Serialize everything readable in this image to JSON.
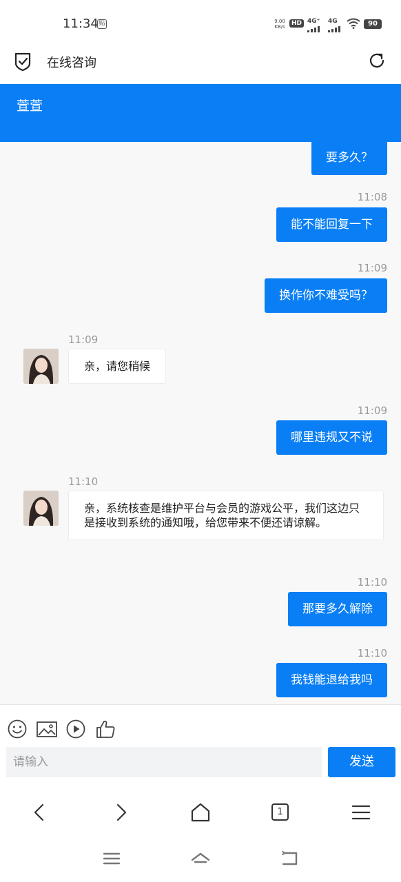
{
  "status_bar": {
    "time": "11:34",
    "tie_label": "贴",
    "net_speed_value": "9.00",
    "net_speed_unit": "KB/s",
    "hd_label": "HD",
    "sim1_label": "4G⁺",
    "sim2_label": "4G",
    "battery": "90"
  },
  "header": {
    "title": "在线咨询"
  },
  "banner": {
    "agent_name": "萱萱"
  },
  "messages": [
    {
      "side": "out",
      "text": "要多久？"
    },
    {
      "time": "11:08"
    },
    {
      "side": "out",
      "text": "能不能回复一下"
    },
    {
      "time": "11:09"
    },
    {
      "side": "out",
      "text": "换作你不难受吗？"
    },
    {
      "time": "11:09"
    },
    {
      "side": "in",
      "text": "亲，请您稍候"
    },
    {
      "time": "11:09"
    },
    {
      "side": "out",
      "text": "哪里违规又不说"
    },
    {
      "time": "11:10"
    },
    {
      "side": "in",
      "text": "亲，系统核查是维护平台与会员的游戏公平，我们这边只是接收到系统的通知哦，给您带来不便还请谅解。"
    },
    {
      "time": "11:10"
    },
    {
      "side": "out",
      "text": "那要多久解除"
    },
    {
      "time": "11:10"
    },
    {
      "side": "out",
      "text": "我钱能退给我吗"
    }
  ],
  "composer": {
    "placeholder": "请输入",
    "send_label": "发送",
    "tools": [
      "emoji-icon",
      "image-icon",
      "video-icon",
      "thumbs-up-icon"
    ]
  },
  "browser_nav": {
    "tab_count": "1"
  },
  "colors": {
    "accent": "#0a7ff5",
    "chat_bg": "#f8f8f8"
  }
}
